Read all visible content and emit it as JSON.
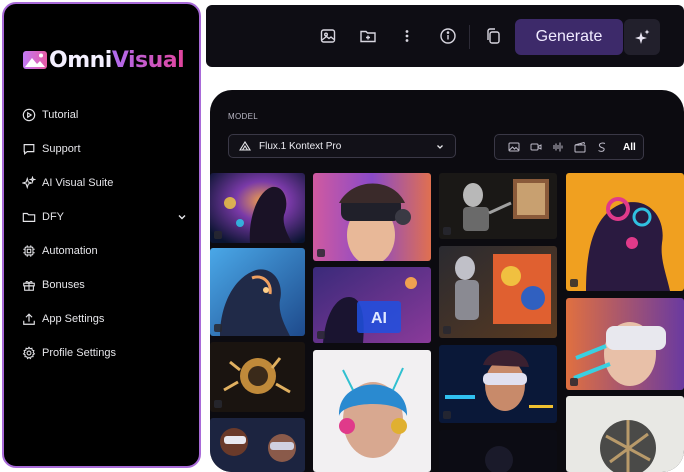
{
  "brand": {
    "name_part1": "Omni",
    "name_part2": "Visual"
  },
  "sidebar": {
    "items": [
      {
        "label": "Tutorial",
        "icon": "play-circle-icon"
      },
      {
        "label": "Support",
        "icon": "chat-bubble-icon"
      },
      {
        "label": "AI Visual Suite",
        "icon": "sparkles-icon"
      },
      {
        "label": "DFY",
        "icon": "folder-icon",
        "has_submenu": true
      },
      {
        "label": "Automation",
        "icon": "chip-icon"
      },
      {
        "label": "Bonuses",
        "icon": "gift-icon"
      },
      {
        "label": "App Settings",
        "icon": "upload-icon"
      },
      {
        "label": "Profile Settings",
        "icon": "gear-icon"
      }
    ]
  },
  "toolbar": {
    "icons": [
      "image-upload-icon",
      "folder-add-icon",
      "more-vertical-icon",
      "info-icon",
      "copy-icon"
    ],
    "generate_label": "Generate",
    "magic_icon": "magic-sparkle-icon"
  },
  "panel": {
    "model_label": "MODEL",
    "model_selected": "Flux.1 Kontext Pro",
    "filters": [
      "image-filter-icon",
      "video-filter-icon",
      "audio-filter-icon",
      "clapper-filter-icon",
      "text-filter-icon"
    ],
    "filter_all_label": "All"
  },
  "gallery": {
    "overlay_text": "AI"
  },
  "colors": {
    "accent": "#3d2a6a",
    "sidebar_border": "#a86ad8",
    "brand_gradient_start": "#b06cf0",
    "brand_gradient_end": "#e0449c"
  }
}
